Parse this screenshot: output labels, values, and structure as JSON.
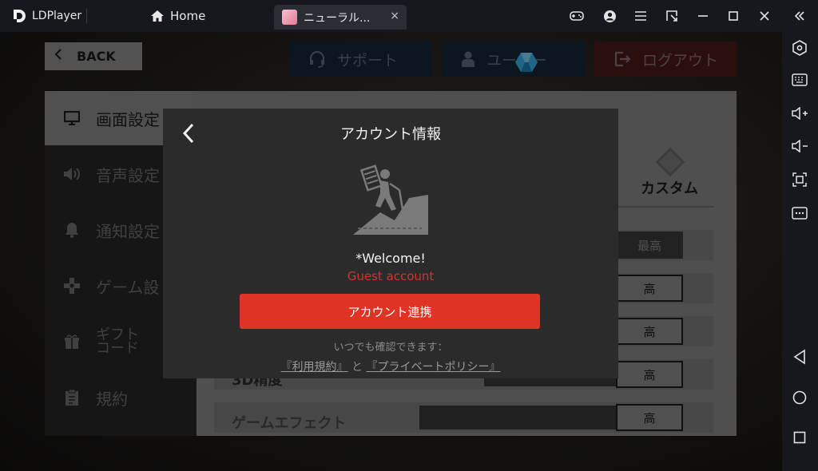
{
  "titlebar": {
    "brand": "LDPlayer",
    "home_tab": "Home",
    "app_tab": "ニューラル...",
    "app_tab_close": "×",
    "icons": [
      "gamepad-icon",
      "user-circle-icon",
      "menu-icon",
      "resize-icon",
      "minimize-icon",
      "maximize-icon",
      "close-icon",
      "collapse-icon"
    ]
  },
  "sidebar": {
    "icons": [
      "settings-hex-icon",
      "keyboard-icon",
      "volume-up-icon",
      "volume-down-icon",
      "screenshot-icon",
      "more-icon",
      "android-back-icon",
      "android-home-icon",
      "android-recents-icon"
    ]
  },
  "game": {
    "back_label": "BACK",
    "support_label": "サポート",
    "user_label": "ユーザー",
    "logout_label": "ログアウト",
    "menu": [
      {
        "label": "画面設定",
        "icon": "monitor-icon"
      },
      {
        "label": "音声設定",
        "icon": "speaker-icon"
      },
      {
        "label": "通知設定",
        "icon": "bell-icon"
      },
      {
        "label": "ゲーム設",
        "icon": "gamepad-cross-icon"
      },
      {
        "label": "ギフト",
        "label2": "コード",
        "icon": "gift-icon"
      },
      {
        "label": "規約",
        "icon": "clipboard-icon"
      }
    ],
    "panel": {
      "custom_label": "カスタム",
      "max_label": "最高",
      "values": [
        "高",
        "高",
        "高",
        "高"
      ],
      "row_label_3d": "3D精度",
      "row_label_effect": "ゲームエフェクト"
    }
  },
  "modal": {
    "title": "アカウント情報",
    "welcome": "*Welcome!",
    "guest": "Guest account",
    "link_button": "アカウント連携",
    "note": "いつでも確認できます：",
    "terms_link": "『利用規約』",
    "and": "と",
    "privacy_link": "『プライベートポリシー』"
  },
  "colors": {
    "accent_red": "#df3326",
    "guest_red": "#d2352a",
    "modal_bg": "#2b2b2b",
    "chrome_bg": "#16181e"
  }
}
